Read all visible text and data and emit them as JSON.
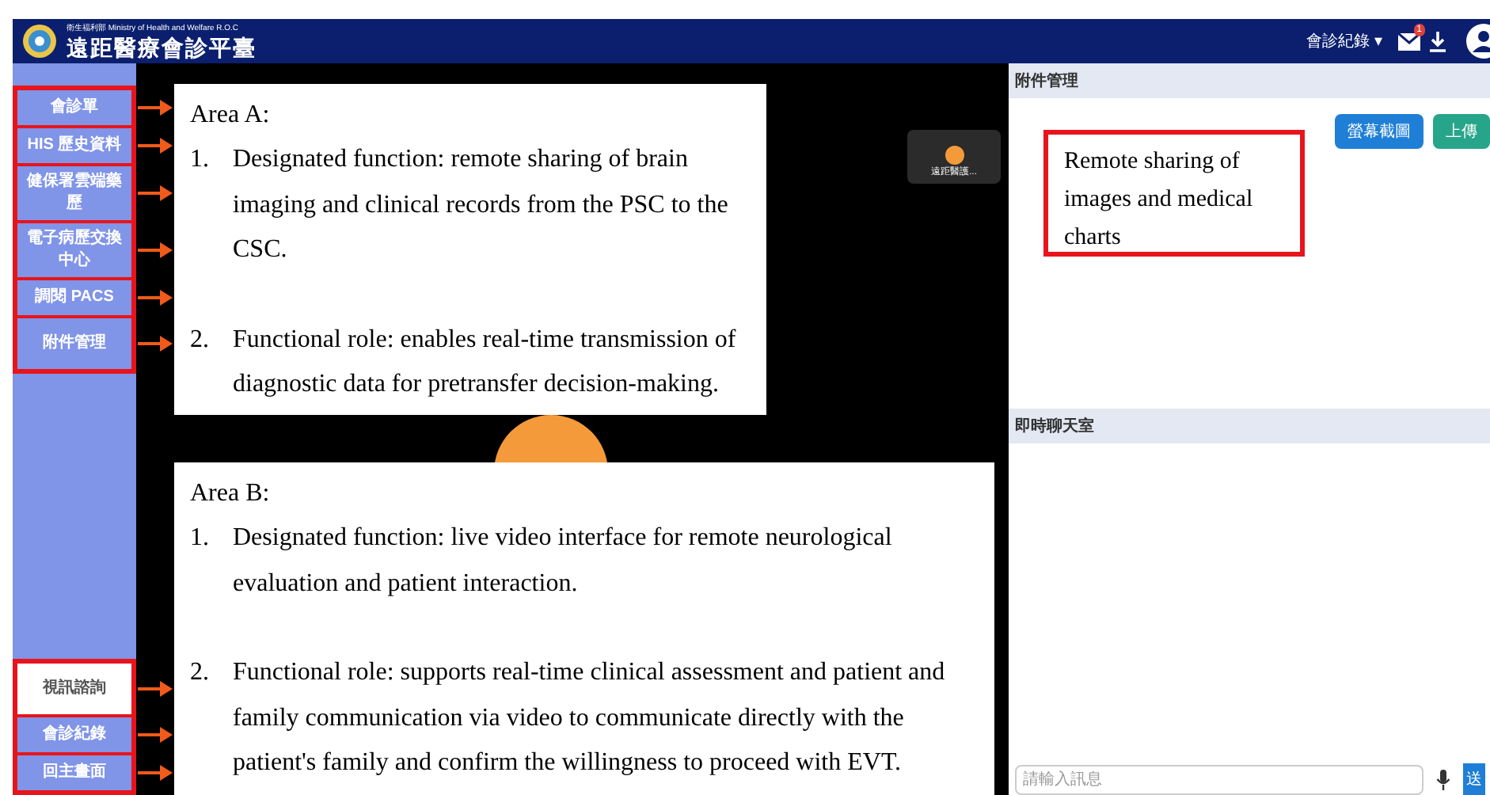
{
  "header": {
    "agency": "衛生福利部 Ministry of Health and Welfare R.O.C",
    "title": "遠距醫療會診平臺",
    "menu_label": "會診紀錄 ▾",
    "mail_badge": "1"
  },
  "sidebar": {
    "groups": [
      {
        "items": [
          {
            "label": "會診單",
            "selected": false
          },
          {
            "label": "HIS 歷史資料",
            "selected": false
          },
          {
            "label": "健保署雲端藥歷",
            "selected": false
          },
          {
            "label": "電子病歷交換中心",
            "selected": false
          },
          {
            "label": "調閱 PACS",
            "selected": false
          },
          {
            "label": "附件管理",
            "selected": false
          }
        ]
      },
      {
        "items": [
          {
            "label": "視訊諮詢",
            "selected": true
          },
          {
            "label": "會診紀錄",
            "selected": false
          },
          {
            "label": "回主畫面",
            "selected": false
          }
        ]
      }
    ]
  },
  "video": {
    "tile_name": "遠距醫護..."
  },
  "callouts": [
    {
      "heading": "Area A:",
      "items": [
        {
          "number": "1.",
          "text": "Designated function: remote sharing of brain imaging and clinical records from the PSC to the CSC."
        },
        {
          "number": "2.",
          "text": "Functional role: enables real-time transmission of diagnostic data for pretransfer decision-making."
        }
      ]
    },
    {
      "heading": "Area B:",
      "items": [
        {
          "number": "1.",
          "text": "Designated function: live video interface for remote neurological evaluation and patient interaction."
        },
        {
          "number": "2.",
          "text": "Functional role: supports real-time clinical assessment and patient and family communication via video to communicate directly with the patient's family and confirm the willingness to proceed with EVT."
        }
      ]
    }
  ],
  "attachments": {
    "title": "附件管理",
    "buttons": [
      "螢幕截圖",
      "上傳"
    ],
    "note": "Remote sharing of images and medical charts"
  },
  "chat": {
    "title": "即時聊天室",
    "placeholder": "請輸入訊息",
    "send_label": "送"
  }
}
